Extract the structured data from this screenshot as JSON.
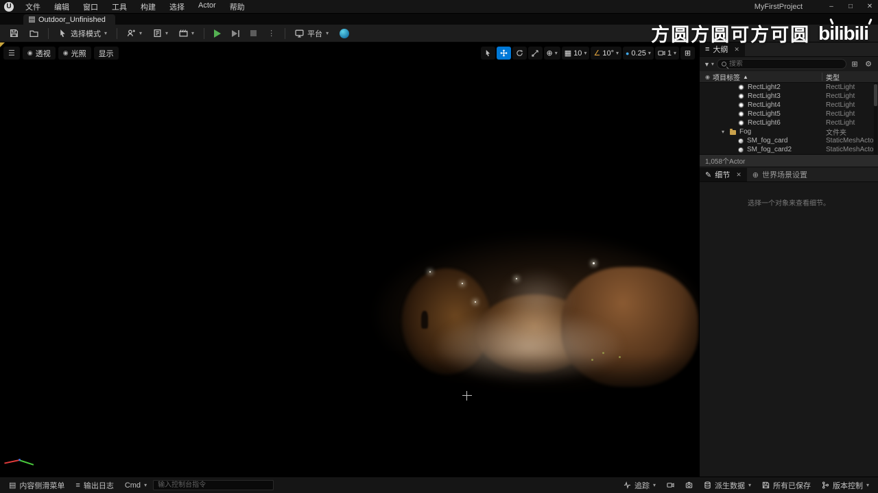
{
  "titlebar": {
    "menus": [
      "文件",
      "编辑",
      "窗口",
      "工具",
      "构建",
      "选择",
      "Actor",
      "帮助"
    ],
    "project_name": "MyFirstProject",
    "logo_letter": "U"
  },
  "asset_tab": {
    "label": "Outdoor_Unfinished"
  },
  "toolbar": {
    "select_mode_label": "选择模式",
    "platform_label": "平台"
  },
  "watermark": {
    "text": "方圆方圆可方可圆",
    "brand": "bilibili"
  },
  "viewport": {
    "perspective_label": "透视",
    "lit_label": "光照",
    "show_label": "显示",
    "grid_snap_value": "10",
    "rotation_snap_value": "10°",
    "scale_snap_value": "0.25",
    "camera_speed_value": "1"
  },
  "outliner": {
    "tab_label": "大纲",
    "search_placeholder": "搜索",
    "col_label": "项目标签",
    "col_type": "类型",
    "rows": [
      {
        "label": "RectLight2",
        "type": "RectLight",
        "icon": "rectlight",
        "indent": 36,
        "expanded": false
      },
      {
        "label": "RectLight3",
        "type": "RectLight",
        "icon": "rectlight",
        "indent": 36,
        "expanded": false
      },
      {
        "label": "RectLight4",
        "type": "RectLight",
        "icon": "rectlight",
        "indent": 36,
        "expanded": false
      },
      {
        "label": "RectLight5",
        "type": "RectLight",
        "icon": "rectlight",
        "indent": 36,
        "expanded": false
      },
      {
        "label": "RectLight6",
        "type": "RectLight",
        "icon": "rectlight",
        "indent": 36,
        "expanded": false
      },
      {
        "label": "Fog",
        "type": "文件夹",
        "icon": "folder",
        "indent": 24,
        "expanded": true
      },
      {
        "label": "SM_fog_card",
        "type": "StaticMeshActo",
        "icon": "mesh",
        "indent": 36,
        "expanded": false
      },
      {
        "label": "SM_fog_card2",
        "type": "StaticMeshActo",
        "icon": "mesh",
        "indent": 36,
        "expanded": false
      }
    ],
    "footer": "1,058个Actor"
  },
  "details": {
    "tab_label": "细节",
    "world_settings_label": "世界场景设置",
    "empty_text": "选择一个对象来查看细节。"
  },
  "statusbar": {
    "content_drawer_label": "内容侧滑菜单",
    "output_log_label": "输出日志",
    "cmd_label": "Cmd",
    "console_placeholder": "输入控制台指令",
    "trace_label": "追踪",
    "derived_data_label": "派生数据",
    "all_saved_label": "所有已保存",
    "revision_control_label": "版本控制"
  },
  "icons": {
    "caret": "▾",
    "caret_up": "▲",
    "menu": "☰",
    "close": "✕",
    "minimize": "–",
    "maximize": "□",
    "ellipsis": "⋮",
    "eye": "◉",
    "grid": "▦",
    "angle": "∠",
    "globe": "⊕",
    "maximize_grid": "⊞",
    "gear": "⚙",
    "pencil": "✎",
    "list": "≡",
    "funnel": "▼",
    "drawer": "▤",
    "scale_dot": "●",
    "diag": "⇲"
  },
  "colors": {
    "accent_blue": "#0079d8",
    "play_green": "#54b152",
    "folder_orange": "#c9a14b"
  }
}
